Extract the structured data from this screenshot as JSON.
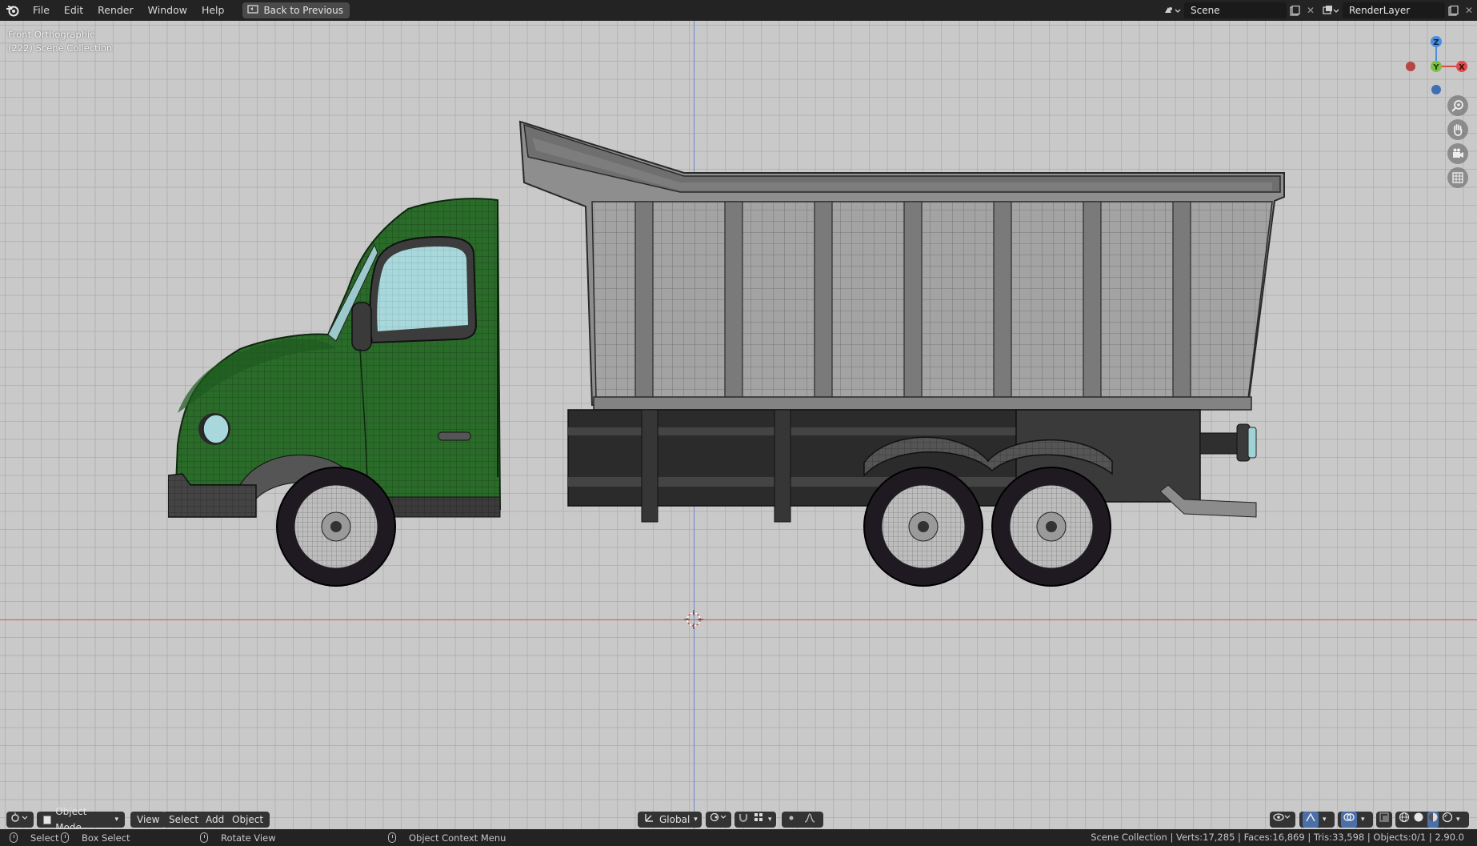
{
  "topbar": {
    "menus": [
      "File",
      "Edit",
      "Render",
      "Window",
      "Help"
    ],
    "back_button": "Back to Previous",
    "scene": "Scene",
    "render_layer": "RenderLayer"
  },
  "viewport": {
    "view_name": "Front Orthographic",
    "collection": "(222) Scene Collection"
  },
  "gizmo": {
    "z": "Z",
    "y": "Y",
    "x": "X"
  },
  "header": {
    "mode": "Object Mode",
    "menus": [
      "View",
      "Select",
      "Add",
      "Object"
    ],
    "transform_orientation": "Global"
  },
  "statusbar": {
    "select": "Select",
    "box_select": "Box Select",
    "rotate_view": "Rotate View",
    "context_menu": "Object Context Menu",
    "stats": "Scene Collection | Verts:17,285 | Faces:16,869 | Tris:33,598 | Objects:0/1 | 2.90.0"
  },
  "colors": {
    "cab": "#2a6b2a",
    "bed": "#9a9a9a",
    "glass": "#a8d8dc",
    "axis_x": "#d94848",
    "axis_y": "#7cc242",
    "axis_z": "#4a8fe0"
  }
}
